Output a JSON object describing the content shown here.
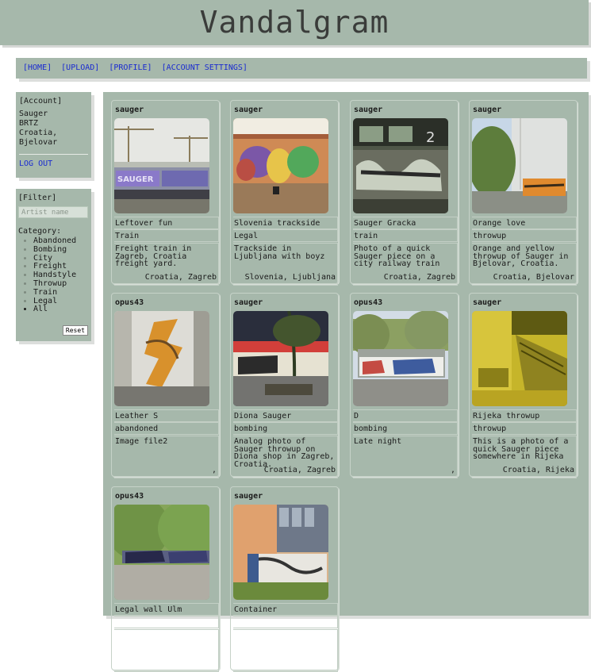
{
  "app": {
    "title": "Vandalgram"
  },
  "nav": [
    "[HOME]",
    "[UPLOAD]",
    "[PROFILE]",
    "[ACCOUNT SETTINGS]"
  ],
  "account": {
    "heading": "[Account]",
    "lines": [
      "Sauger",
      "BRTZ",
      "Croatia,",
      "Bjelovar"
    ],
    "logout": "LOG OUT"
  },
  "filter": {
    "heading": "[Filter]",
    "artist_placeholder": "Artist name",
    "category_label": "Category:",
    "categories": [
      "Abandoned",
      "Bombing",
      "City",
      "Freight",
      "Handstyle",
      "Throwup",
      "Train",
      "Legal",
      "All"
    ],
    "reset_label": "Reset"
  },
  "posts": [
    {
      "user": "sauger",
      "title": "Leftover fun",
      "category": "Train",
      "description": "Freight train in Zagreb, Croatia freight yard.",
      "location": "Croatia, Zagreb",
      "thumb": "freight"
    },
    {
      "user": "sauger",
      "title": "Slovenia trackside",
      "category": "Legal",
      "description": "Trackside in Ljubljana with boyz",
      "location": "Slovenia, Ljubljana",
      "thumb": "trackside"
    },
    {
      "user": "sauger",
      "title": "Sauger Gracka",
      "category": "train",
      "description": "Photo of a quick Sauger piece on a city railway train",
      "location": "Croatia, Zagreb",
      "thumb": "citytrain"
    },
    {
      "user": "sauger",
      "title": "Orange love",
      "category": "throwup",
      "description": "Orange and yellow throwup of Sauger in Bjelovar, Croatia.",
      "location": "Croatia, Bjelovar",
      "thumb": "orange"
    },
    {
      "user": "opus43",
      "title": "Leather S",
      "category": "abandoned",
      "description": "Image file2",
      "location": ",",
      "thumb": "leather"
    },
    {
      "user": "sauger",
      "title": "Diona Sauger",
      "category": "bombing",
      "description": "Analog photo of Sauger throwup on Diona shop in Zagreb, Croatia.",
      "location": "Croatia, Zagreb",
      "thumb": "diona"
    },
    {
      "user": "opus43",
      "title": "D",
      "category": "bombing",
      "description": "Late night",
      "location": ",",
      "thumb": "bus"
    },
    {
      "user": "sauger",
      "title": "Rijeka throwup",
      "category": "throwup",
      "description": "This is a photo of a quick Sauger piece somewhere in Rijeka",
      "location": "Croatia, Rijeka",
      "thumb": "rijeka"
    },
    {
      "user": "opus43",
      "title": "Legal wall Ulm",
      "category": "",
      "description": "",
      "location": "",
      "thumb": "ulm"
    },
    {
      "user": "sauger",
      "title": "Container",
      "category": "",
      "description": "",
      "location": "",
      "thumb": "container"
    }
  ],
  "colors": {
    "panel": "#a6b8ab",
    "link": "#1a2bd0",
    "text": "#1b1b1b"
  }
}
